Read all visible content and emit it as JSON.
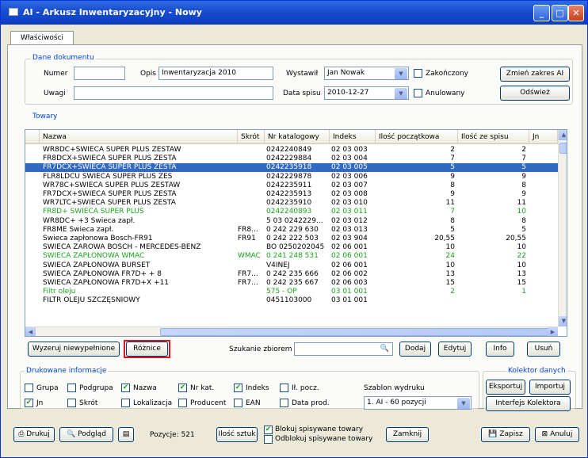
{
  "window": {
    "title": "AI - Arkusz Inwentaryzacyjny - Nowy",
    "min": "_",
    "max": "□",
    "close": "✕"
  },
  "tab": {
    "label": "Właściwości"
  },
  "doc": {
    "group": "Dane dokumentu",
    "numer_label": "Numer",
    "numer_value": "",
    "opis_label": "Opis",
    "opis_value": "Inwentaryzacja 2010",
    "wystawil_label": "Wystawił",
    "wystawil_value": "Jan Nowak",
    "zakonczony_label": "Zakończony",
    "zmien_label": "Zmień zakres AI",
    "uwagi_label": "Uwagi",
    "uwagi_value": "",
    "data_label": "Data spisu",
    "data_value": "2010-12-27",
    "anulowany_label": "Anulowany",
    "odswiez_label": "Odśwież"
  },
  "towary": {
    "group": "Towary",
    "columns": [
      "Nazwa",
      "Skrót",
      "Nr katalogowy",
      "Indeks",
      "Ilość początkowa",
      "Ilość ze spisu",
      "Jn"
    ],
    "rows": [
      {
        "n": "WR8DC+ŚWIECA SUPER PLUS ZESTAW",
        "s": "",
        "k": "0242240849",
        "i": "02 03 003",
        "p": "2",
        "z": "2",
        "st": ""
      },
      {
        "n": "FR8DCX+ŚWIECA SUPER PLUS ZESTA",
        "s": "",
        "k": "0242229884",
        "i": "02 03 004",
        "p": "7",
        "z": "7",
        "st": ""
      },
      {
        "n": "FR7DCX+ŚWIECA SUPER PLUS ZESTA",
        "s": "",
        "k": "0242235918",
        "i": "02 03 005",
        "p": "5",
        "z": "5",
        "st": "sel"
      },
      {
        "n": "FLR8LDCU ŚWIECA SUPER PLUS ZES",
        "s": "",
        "k": "0242229878",
        "i": "02 03 006",
        "p": "9",
        "z": "9",
        "st": ""
      },
      {
        "n": "WR78C+ŚWIECA SUPER PLUS ZESTAW",
        "s": "",
        "k": "0242235911",
        "i": "02 03 007",
        "p": "8",
        "z": "8",
        "st": ""
      },
      {
        "n": "FR7DCX+ŚWIECA SUPER PLUS ZESTA",
        "s": "",
        "k": "0242235913",
        "i": "02 03 008",
        "p": "9",
        "z": "9",
        "st": ""
      },
      {
        "n": "WR7LTC+ŚWIECA SUPER PLUS ZESTA",
        "s": "",
        "k": "0242235910",
        "i": "02 03 010",
        "p": "11",
        "z": "11",
        "st": ""
      },
      {
        "n": "FR8D+ ŚWIECA SUPER PLUS",
        "s": "",
        "k": "0242240893",
        "i": "02 03 011",
        "p": "7",
        "z": "10",
        "st": "grn"
      },
      {
        "n": "WR8DC+      +3 Świeca zapł.",
        "s": "",
        "k": "5 03 0242229...",
        "i": "02 03 012",
        "p": "8",
        "z": "8",
        "st": ""
      },
      {
        "n": "FR8ME         Świeca zapł.",
        "s": "FR8...",
        "k": "0 242 229 630",
        "i": "02 03 013",
        "p": "5",
        "z": "5",
        "st": ""
      },
      {
        "n": "Świeca zapłonowa Bosch-FR91",
        "s": "FR91",
        "k": "0 242 222 503",
        "i": "02 03 904",
        "p": "20,55",
        "z": "20,55",
        "st": ""
      },
      {
        "n": "ŚWIECA ŻAROWA BOSCH - MERCEDES-BENZ",
        "s": "",
        "k": "BO 0250202045",
        "i": "02 06 001",
        "p": "10",
        "z": "10",
        "st": ""
      },
      {
        "n": "ŚWIECA ZAPŁONOWA WMAC",
        "s": "WMAC",
        "k": "0 241 248 531",
        "i": "02 06 001",
        "p": "24",
        "z": "22",
        "st": "grn"
      },
      {
        "n": "ŚWIECA ZAPŁONOWA BURSET",
        "s": "",
        "k": "V4INEJ",
        "i": "02 06 001",
        "p": "10",
        "z": "10",
        "st": ""
      },
      {
        "n": "ŚWIECA ZAPŁONOWA FR7D+ + 8",
        "s": "FR7...",
        "k": "0 242 235 666",
        "i": "02 06 002",
        "p": "13",
        "z": "13",
        "st": ""
      },
      {
        "n": "ŚWIECA ZAPŁONOWA FR7D+X +11",
        "s": "FR7...",
        "k": "0 242 235 667",
        "i": "02 06 003",
        "p": "15",
        "z": "15",
        "st": ""
      },
      {
        "n": "Filtr oleju",
        "s": "",
        "k": "575 - OP",
        "i": "03 01 001",
        "p": "2",
        "z": "1",
        "st": "grn"
      },
      {
        "n": "FILTR OLEJU SZCZĘŚNIOWY",
        "s": "",
        "k": "0451103000",
        "i": "03 01 001",
        "p": "",
        "z": "",
        "st": ""
      }
    ]
  },
  "actions": {
    "wyzeruj": "Wyzeruj niewypełnione",
    "roznice": "Różnice",
    "szukanie_label": "Szukanie zbiorem",
    "szukanie_value": "",
    "dodaj": "Dodaj",
    "edytuj": "Edytuj",
    "info": "Info",
    "usun": "Usuń"
  },
  "druk": {
    "group": "Drukowane informacje",
    "grupa": "Grupa",
    "podgrupa": "Podgrupa",
    "nazwa": "Nazwa",
    "nrkat": "Nr kat.",
    "indeks": "Indeks",
    "ilpocz": "Ił. pocz.",
    "jn": "Jn",
    "skrot": "Skrót",
    "lokalizacja": "Lokalizacja",
    "producent": "Producent",
    "ean": "EAN",
    "dataprod": "Data prod.",
    "szablon_label": "Szablon wydruku",
    "szablon_value": "1. AI - 60 pozycji"
  },
  "kolektor": {
    "group": "Kolektor danych",
    "eksportuj": "Eksportuj",
    "importuj": "Importuj",
    "interfejs": "Interfejs Kolektora"
  },
  "bottom": {
    "drukuj": "Drukuj",
    "podglad": "Podgląd",
    "pozycje": "Pozycje: 521",
    "ilosc": "Ilość sztuk",
    "blokuj": "Blokuj spisywane towary",
    "odblokuj": "Odblokuj spisywane towary",
    "zamknij": "Zamknij",
    "zapisz": "Zapisz",
    "anuluj": "Anuluj"
  }
}
